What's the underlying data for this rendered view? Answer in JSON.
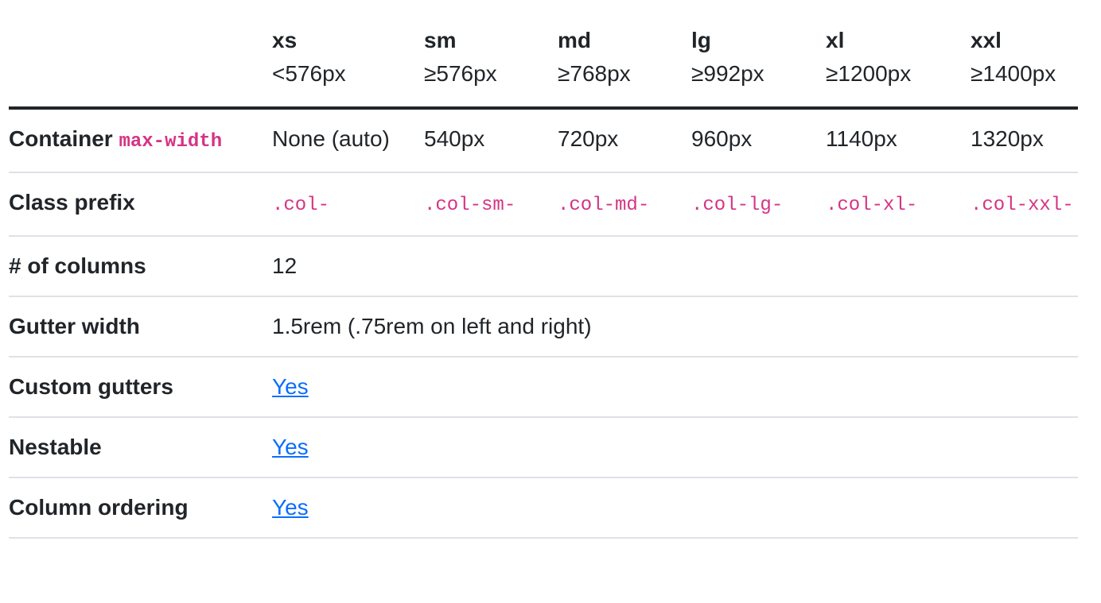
{
  "breakpoints": [
    {
      "name": "xs",
      "range": "<576px"
    },
    {
      "name": "sm",
      "range": "≥576px"
    },
    {
      "name": "md",
      "range": "≥768px"
    },
    {
      "name": "lg",
      "range": "≥992px"
    },
    {
      "name": "xl",
      "range": "≥1200px"
    },
    {
      "name": "xxl",
      "range": "≥1400px"
    }
  ],
  "rows": {
    "container": {
      "label": "Container",
      "label_code": "max-width",
      "values": [
        "None (auto)",
        "540px",
        "720px",
        "960px",
        "1140px",
        "1320px"
      ]
    },
    "class_prefix": {
      "label": "Class prefix",
      "values": [
        ".col-",
        ".col-sm-",
        ".col-md-",
        ".col-lg-",
        ".col-xl-",
        ".col-xxl-"
      ]
    },
    "columns": {
      "label": "# of columns",
      "value": "12"
    },
    "gutter_width": {
      "label": "Gutter width",
      "value": "1.5rem (.75rem on left and right)"
    },
    "custom_gutters": {
      "label": "Custom gutters",
      "value": "Yes"
    },
    "nestable": {
      "label": "Nestable",
      "value": "Yes"
    },
    "column_ordering": {
      "label": "Column ordering",
      "value": "Yes"
    }
  },
  "colors": {
    "text": "#212529",
    "code": "#d63384",
    "link": "#0d6efd",
    "border": "#dee2e6"
  }
}
